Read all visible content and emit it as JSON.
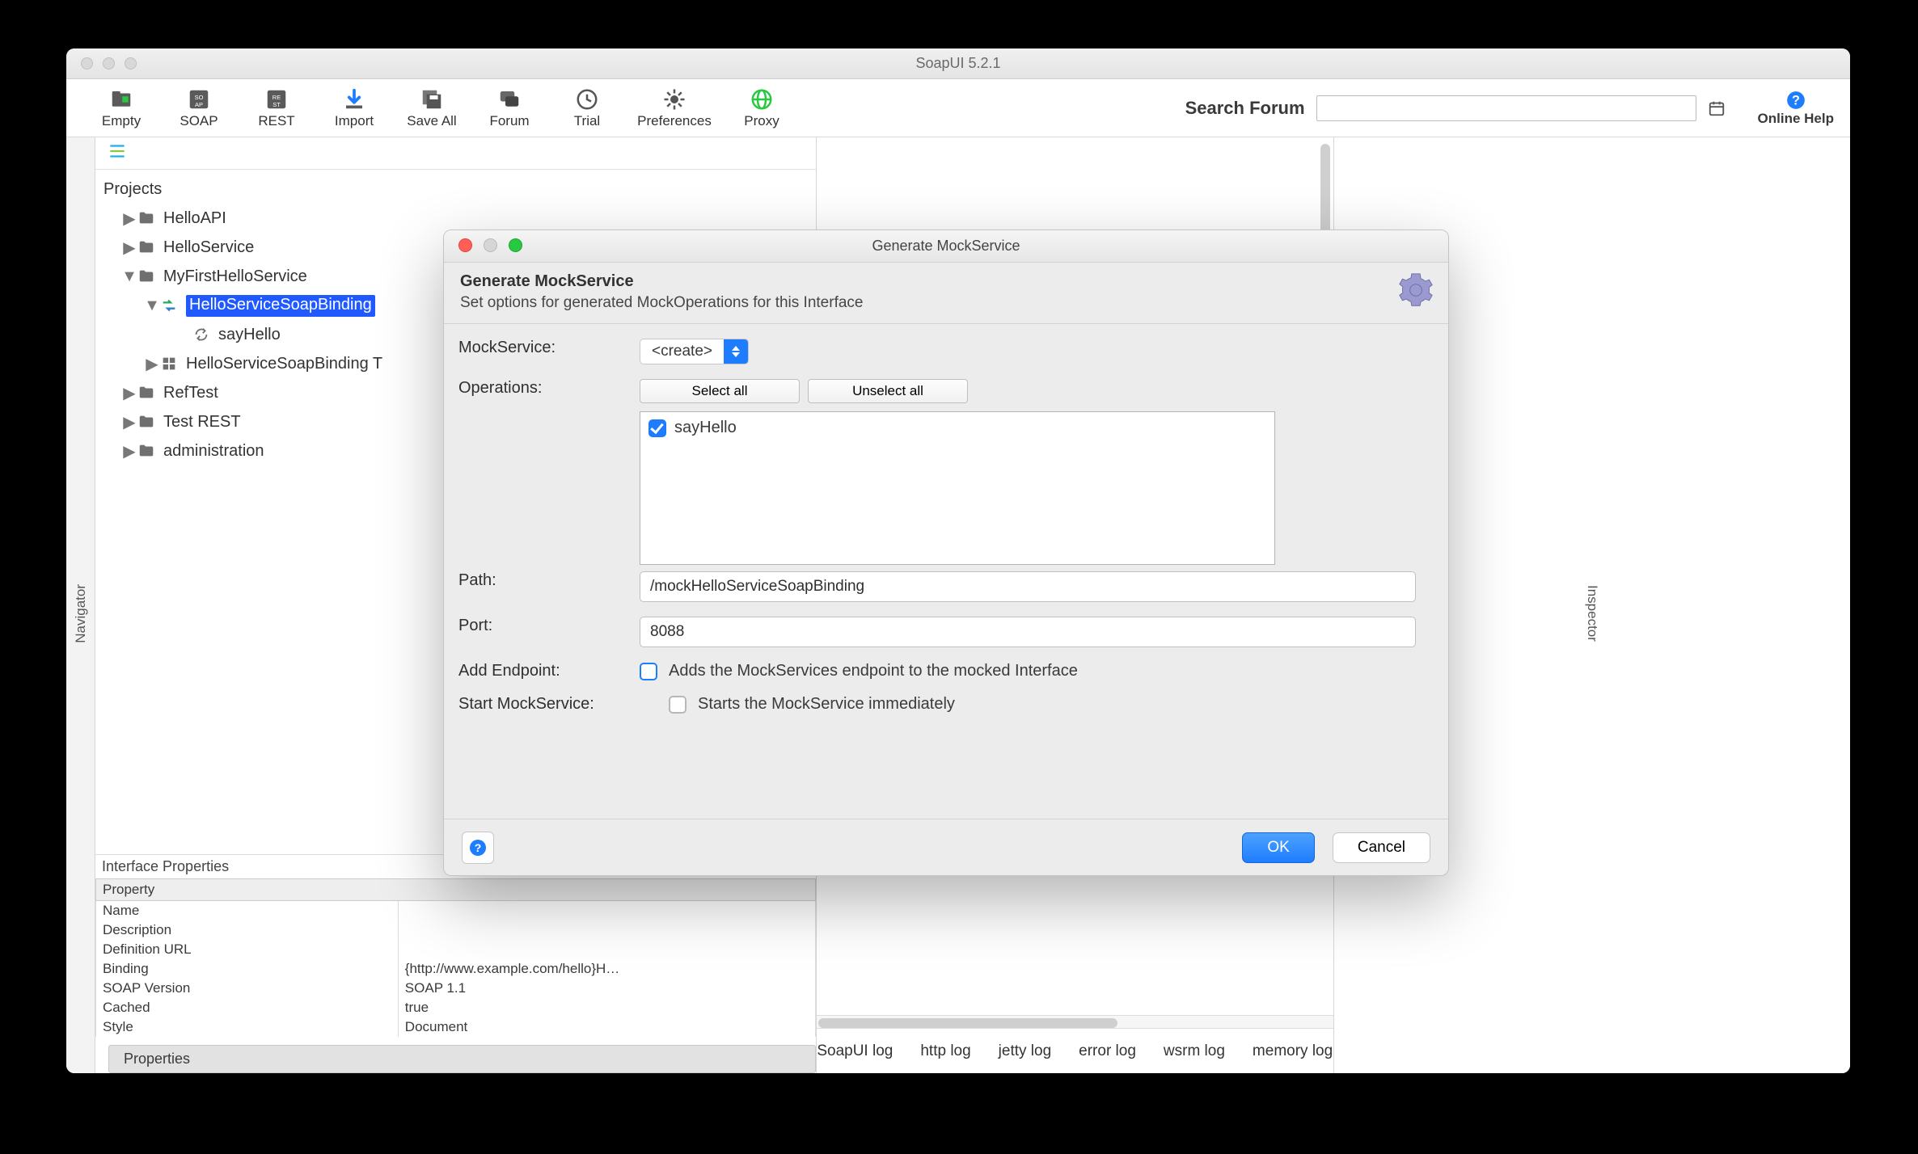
{
  "window": {
    "title": "SoapUI 5.2.1"
  },
  "toolbar": {
    "buttons": [
      {
        "label": "Empty"
      },
      {
        "label": "SOAP"
      },
      {
        "label": "REST"
      },
      {
        "label": "Import"
      },
      {
        "label": "Save All"
      },
      {
        "label": "Forum"
      },
      {
        "label": "Trial"
      },
      {
        "label": "Preferences"
      },
      {
        "label": "Proxy"
      }
    ],
    "search_label": "Search Forum",
    "search_value": "",
    "help_label": "Online Help"
  },
  "sidebars": {
    "left": "Navigator",
    "right": "Inspector"
  },
  "tree": {
    "root": "Projects",
    "nodes": [
      {
        "label": "HelloAPI",
        "type": "folder",
        "expanded": false,
        "level": 1
      },
      {
        "label": "HelloService",
        "type": "folder",
        "expanded": false,
        "level": 1
      },
      {
        "label": "MyFirstHelloService",
        "type": "folder",
        "expanded": true,
        "level": 1
      },
      {
        "label": "HelloServiceSoapBinding",
        "type": "binding",
        "expanded": true,
        "selected": true,
        "level": 2
      },
      {
        "label": "sayHello",
        "type": "op",
        "level": 3
      },
      {
        "label": "HelloServiceSoapBinding T",
        "type": "suite",
        "expanded": false,
        "level": 2
      },
      {
        "label": "RefTest",
        "type": "folder",
        "expanded": false,
        "level": 1
      },
      {
        "label": "Test REST",
        "type": "folder",
        "expanded": false,
        "level": 1
      },
      {
        "label": "administration",
        "type": "folder",
        "expanded": false,
        "level": 1
      }
    ]
  },
  "properties": {
    "title": "Interface Properties",
    "header": "Property",
    "rows": [
      {
        "name": "Name",
        "value": ""
      },
      {
        "name": "Description",
        "value": ""
      },
      {
        "name": "Definition URL",
        "value": ""
      },
      {
        "name": "Binding",
        "value": "{http://www.example.com/hello}H…"
      },
      {
        "name": "SOAP Version",
        "value": "SOAP 1.1"
      },
      {
        "name": "Cached",
        "value": "true"
      },
      {
        "name": "Style",
        "value": "Document"
      }
    ],
    "tab": "Properties"
  },
  "logs": [
    "SoapUI log",
    "http log",
    "jetty log",
    "error log",
    "wsrm log",
    "memory log"
  ],
  "dialog": {
    "title": "Generate MockService",
    "heading": "Generate MockService",
    "subheading": "Set options for generated MockOperations for this Interface",
    "fields": {
      "mockservice": {
        "label": "MockService:",
        "value": "<create>"
      },
      "operations": {
        "label": "Operations:",
        "select_all": "Select all",
        "unselect_all": "Unselect all",
        "items": [
          {
            "label": "sayHello",
            "checked": true
          }
        ]
      },
      "path": {
        "label": "Path:",
        "value": "/mockHelloServiceSoapBinding"
      },
      "port": {
        "label": "Port:",
        "value": "8088"
      },
      "add_endpoint": {
        "label": "Add Endpoint:",
        "text": "Adds the MockServices endpoint to the mocked Interface",
        "checked": false,
        "outline": true
      },
      "start": {
        "label": "Start MockService:",
        "text": "Starts the MockService immediately",
        "checked": false
      }
    },
    "ok": "OK",
    "cancel": "Cancel"
  }
}
